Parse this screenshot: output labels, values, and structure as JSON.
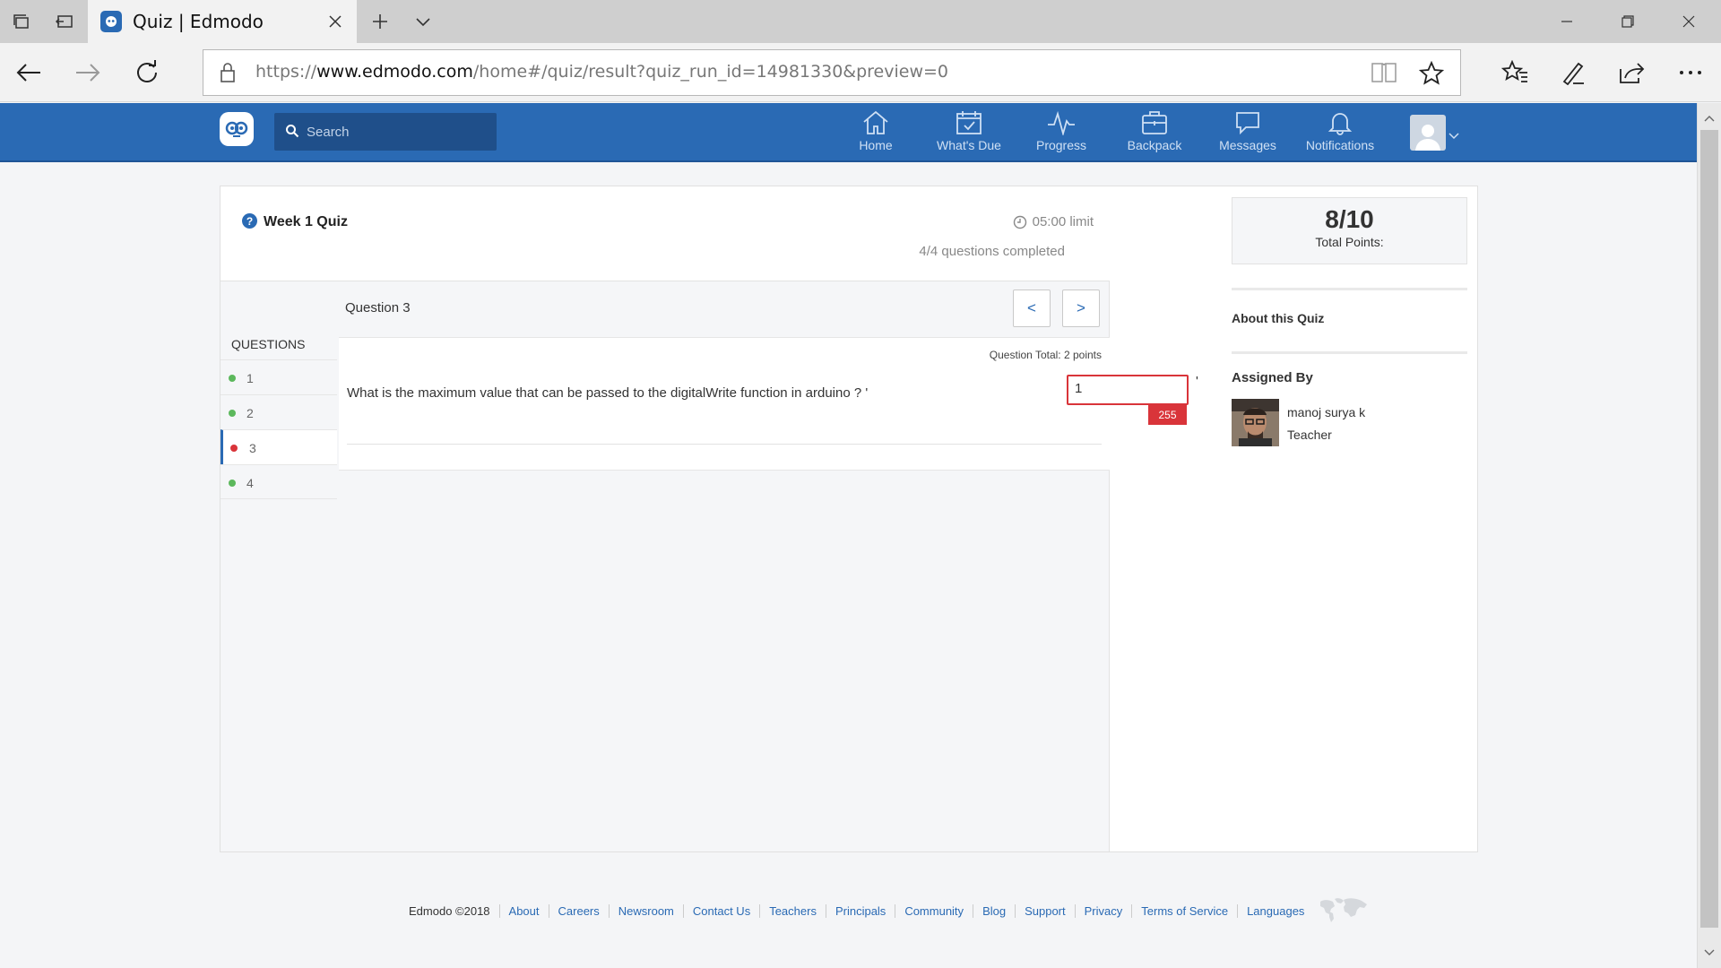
{
  "browser": {
    "tab_title": "Quiz | Edmodo",
    "url_prefix": "https://",
    "url_domain": "www.edmodo.com",
    "url_path": "/home#/quiz/result?quiz_run_id=14981330&preview=0"
  },
  "header": {
    "search_placeholder": "Search",
    "nav": [
      {
        "label": "Home",
        "icon": "home-icon"
      },
      {
        "label": "What's Due",
        "icon": "calendar-check-icon"
      },
      {
        "label": "Progress",
        "icon": "progress-pulse-icon"
      },
      {
        "label": "Backpack",
        "icon": "backpack-icon"
      },
      {
        "label": "Messages",
        "icon": "message-bubble-icon"
      },
      {
        "label": "Notifications",
        "icon": "bell-icon"
      }
    ]
  },
  "quiz": {
    "title": "Week 1 Quiz",
    "time_limit": "05:00 limit",
    "completed": "4/4 questions completed",
    "current_question_label": "Question 3",
    "prev_label": "<",
    "next_label": ">",
    "questions_heading": "QUESTIONS",
    "questions": [
      {
        "number": "1",
        "status": "correct"
      },
      {
        "number": "2",
        "status": "correct"
      },
      {
        "number": "3",
        "status": "incorrect",
        "active": true
      },
      {
        "number": "4",
        "status": "correct"
      }
    ],
    "question_total": "Question Total: 2 points",
    "question_text": "What is the maximum value that can be passed to the digitalWrite function in arduino ? '",
    "answer_value": "1",
    "correct_answer": "255",
    "question_tail": "'"
  },
  "sidebar": {
    "score": "8/10",
    "score_label": "Total Points:",
    "about_title": "About this Quiz",
    "assigned_title": "Assigned By",
    "teacher_name": "manoj surya k",
    "teacher_role": "Teacher"
  },
  "footer": {
    "copyright": "Edmodo ©2018",
    "links": [
      "About",
      "Careers",
      "Newsroom",
      "Contact Us",
      "Teachers",
      "Principals",
      "Community",
      "Blog",
      "Support",
      "Privacy",
      "Terms of Service",
      "Languages"
    ]
  },
  "colors": {
    "brand_blue": "#2a6ab4",
    "correct_green": "#5cb85c",
    "incorrect_red": "#d9343a"
  }
}
